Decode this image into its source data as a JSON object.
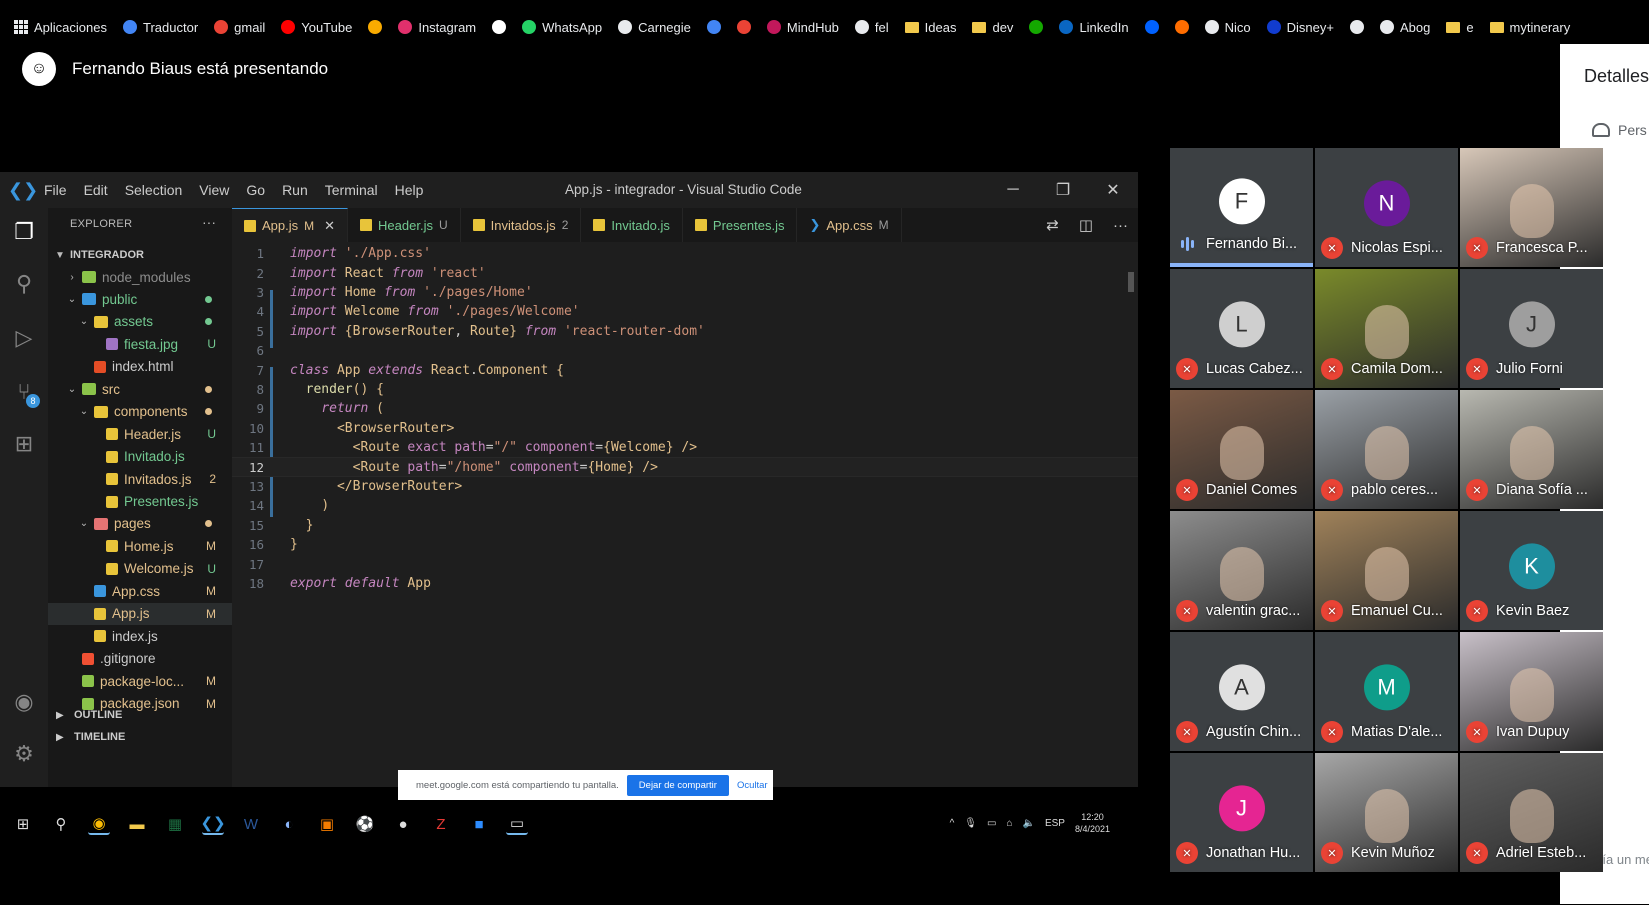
{
  "bookmarks": [
    {
      "label": "Aplicaciones",
      "color": "#e8eaed"
    },
    {
      "label": "Traductor",
      "color": "#4285f4"
    },
    {
      "label": "gmail",
      "color": "#ea4335"
    },
    {
      "label": "YouTube",
      "color": "#ff0000"
    },
    {
      "label": "",
      "color": "#f9ab00"
    },
    {
      "label": "Instagram",
      "color": "#e1306c"
    },
    {
      "label": "",
      "color": "#ffffff"
    },
    {
      "label": "WhatsApp",
      "color": "#25d366"
    },
    {
      "label": "Carnegie",
      "color": "#e8eaed"
    },
    {
      "label": "",
      "color": "#4285f4"
    },
    {
      "label": "",
      "color": "#ea4335"
    },
    {
      "label": "MindHub",
      "color": "#c2185b"
    },
    {
      "label": "fel",
      "color": "#e8eaed"
    },
    {
      "label": "Ideas",
      "color": "#f2c94c"
    },
    {
      "label": "dev",
      "color": "#f2c94c"
    },
    {
      "label": "",
      "color": "#14a800"
    },
    {
      "label": "LinkedIn",
      "color": "#0a66c2"
    },
    {
      "label": "",
      "color": "#0061ff"
    },
    {
      "label": "",
      "color": "#ff6d00"
    },
    {
      "label": "Nico",
      "color": "#e8eaed"
    },
    {
      "label": "Disney+",
      "color": "#113ccf"
    },
    {
      "label": "",
      "color": "#e8eaed"
    },
    {
      "label": "Abog",
      "color": "#e8eaed"
    },
    {
      "label": "e",
      "color": "#f2c94c"
    },
    {
      "label": "mytinerary",
      "color": "#f2c94c"
    }
  ],
  "presenter": {
    "label": "Fernando Biaus está presentando"
  },
  "details_panel": {
    "title": "Detalles",
    "people_tab": "Pers",
    "chat_placeholder": "Envía un me"
  },
  "vscode": {
    "menu": [
      "File",
      "Edit",
      "Selection",
      "View",
      "Go",
      "Run",
      "Terminal",
      "Help"
    ],
    "title": "App.js - integrador - Visual Studio Code",
    "explorer_title": "EXPLORER",
    "project": "INTEGRADOR",
    "tree": [
      {
        "label": "node_modules",
        "status": "",
        "depth": 1,
        "kind": "folder",
        "color": "gray"
      },
      {
        "label": "public",
        "status": "",
        "depth": 1,
        "kind": "folder-open",
        "color": "green"
      },
      {
        "label": "assets",
        "status": "",
        "depth": 2,
        "kind": "folder-open",
        "color": "green"
      },
      {
        "label": "fiesta.jpg",
        "status": "U",
        "depth": 3,
        "kind": "file",
        "color": "green"
      },
      {
        "label": "index.html",
        "status": "",
        "depth": 2,
        "kind": "file",
        "color": "white"
      },
      {
        "label": "src",
        "status": "",
        "depth": 1,
        "kind": "folder-open",
        "color": "yellow"
      },
      {
        "label": "components",
        "status": "",
        "depth": 2,
        "kind": "folder-open",
        "color": "yellow"
      },
      {
        "label": "Header.js",
        "status": "U",
        "depth": 3,
        "kind": "file",
        "color": "yellow"
      },
      {
        "label": "Invitado.js",
        "status": "",
        "depth": 3,
        "kind": "file",
        "color": "green"
      },
      {
        "label": "Invitados.js",
        "status": "2",
        "depth": 3,
        "kind": "file",
        "color": "yellow"
      },
      {
        "label": "Presentes.js",
        "status": "",
        "depth": 3,
        "kind": "file",
        "color": "green"
      },
      {
        "label": "pages",
        "status": "",
        "depth": 2,
        "kind": "folder-open",
        "color": "yellow"
      },
      {
        "label": "Home.js",
        "status": "M",
        "depth": 3,
        "kind": "file",
        "color": "yellow"
      },
      {
        "label": "Welcome.js",
        "status": "U",
        "depth": 3,
        "kind": "file",
        "color": "yellow"
      },
      {
        "label": "App.css",
        "status": "M",
        "depth": 2,
        "kind": "file",
        "color": "yellow"
      },
      {
        "label": "App.js",
        "status": "M",
        "depth": 2,
        "kind": "file",
        "color": "yellow"
      },
      {
        "label": "index.js",
        "status": "",
        "depth": 2,
        "kind": "file",
        "color": "white"
      },
      {
        "label": ".gitignore",
        "status": "",
        "depth": 1,
        "kind": "file",
        "color": "white"
      },
      {
        "label": "package-loc...",
        "status": "M",
        "depth": 1,
        "kind": "file",
        "color": "yellow"
      },
      {
        "label": "package.json",
        "status": "M",
        "depth": 1,
        "kind": "file",
        "color": "yellow"
      }
    ],
    "sections": [
      "OUTLINE",
      "TIMELINE"
    ],
    "tabs": [
      {
        "label": "App.js",
        "flag": "M",
        "active": true
      },
      {
        "label": "Header.js",
        "flag": "U",
        "active": false
      },
      {
        "label": "Invitados.js",
        "flag": "2",
        "active": false
      },
      {
        "label": "Invitado.js",
        "flag": "",
        "active": false
      },
      {
        "label": "Presentes.js",
        "flag": "",
        "active": false
      },
      {
        "label": "App.css",
        "flag": "M",
        "active": false
      }
    ],
    "code_lines": [
      "import './App.css'",
      "import React from 'react'",
      "import Home from './pages/Home'",
      "import Welcome from './pages/Welcome'",
      "import {BrowserRouter, Route} from 'react-router-dom'",
      "",
      "class App extends React.Component {",
      "  render() {",
      "    return (",
      "      <BrowserRouter>",
      "        <Route exact path=\"/\" component={Welcome} />",
      "        <Route path=\"/home\" component={Home} />",
      "      </BrowserRouter>",
      "    )",
      "  }",
      "}",
      "",
      "export default App"
    ],
    "current_line": 12
  },
  "share_banner": {
    "text": "meet.google.com está compartiendo tu pantalla.",
    "stop": "Dejar de compartir",
    "hide": "Ocultar"
  },
  "taskbar": {
    "lang": "ESP",
    "time": "12:20",
    "date": "8/4/2021"
  },
  "participants": [
    {
      "name": "Fernando Bi...",
      "muted": false,
      "avatar": "F",
      "avatar_color": "#ffffff",
      "video": false
    },
    {
      "name": "Nicolas Espi...",
      "muted": true,
      "avatar": "N",
      "avatar_color": "#6a1b9a",
      "video": false
    },
    {
      "name": "Francesca P...",
      "muted": true,
      "avatar": "",
      "avatar_color": "#d7c7b8",
      "video": true
    },
    {
      "name": "Lucas Cabez...",
      "muted": true,
      "avatar": "L",
      "avatar_color": "#cfcfcf",
      "video": false
    },
    {
      "name": "Camila Dom...",
      "muted": true,
      "avatar": "",
      "avatar_color": "#7a8a2a",
      "video": true
    },
    {
      "name": "Julio Forni",
      "muted": true,
      "avatar": "J",
      "avatar_color": "#9e9e9e",
      "video": false
    },
    {
      "name": "Daniel Comes",
      "muted": true,
      "avatar": "",
      "avatar_color": "#7b5a45",
      "video": true
    },
    {
      "name": "pablo ceres...",
      "muted": true,
      "avatar": "",
      "avatar_color": "#9aa0a6",
      "video": true
    },
    {
      "name": "Diana Sofía ...",
      "muted": true,
      "avatar": "",
      "avatar_color": "#b8b8b0",
      "video": true
    },
    {
      "name": "valentin grac...",
      "muted": true,
      "avatar": "",
      "avatar_color": "#8d8d8d",
      "video": true
    },
    {
      "name": "Emanuel Cu...",
      "muted": true,
      "avatar": "",
      "avatar_color": "#a0825a",
      "video": true
    },
    {
      "name": "Kevin Baez",
      "muted": true,
      "avatar": "K",
      "avatar_color": "#1e8e9e",
      "video": false
    },
    {
      "name": "Agustín Chin...",
      "muted": true,
      "avatar": "A",
      "avatar_color": "#e0e0e0",
      "video": false
    },
    {
      "name": "Matias D'ale...",
      "muted": true,
      "avatar": "M",
      "avatar_color": "#0f9d8a",
      "video": false
    },
    {
      "name": "Ivan Dupuy",
      "muted": true,
      "avatar": "",
      "avatar_color": "#c8c0c8",
      "video": true
    },
    {
      "name": "Jonathan Hu...",
      "muted": true,
      "avatar": "J",
      "avatar_color": "#e52592",
      "video": false
    },
    {
      "name": "Kevin Muñoz",
      "muted": true,
      "avatar": "",
      "avatar_color": "#a7a7a7",
      "video": true
    },
    {
      "name": "Adriel Esteb...",
      "muted": true,
      "avatar": "",
      "avatar_color": "#606060",
      "video": true
    }
  ]
}
